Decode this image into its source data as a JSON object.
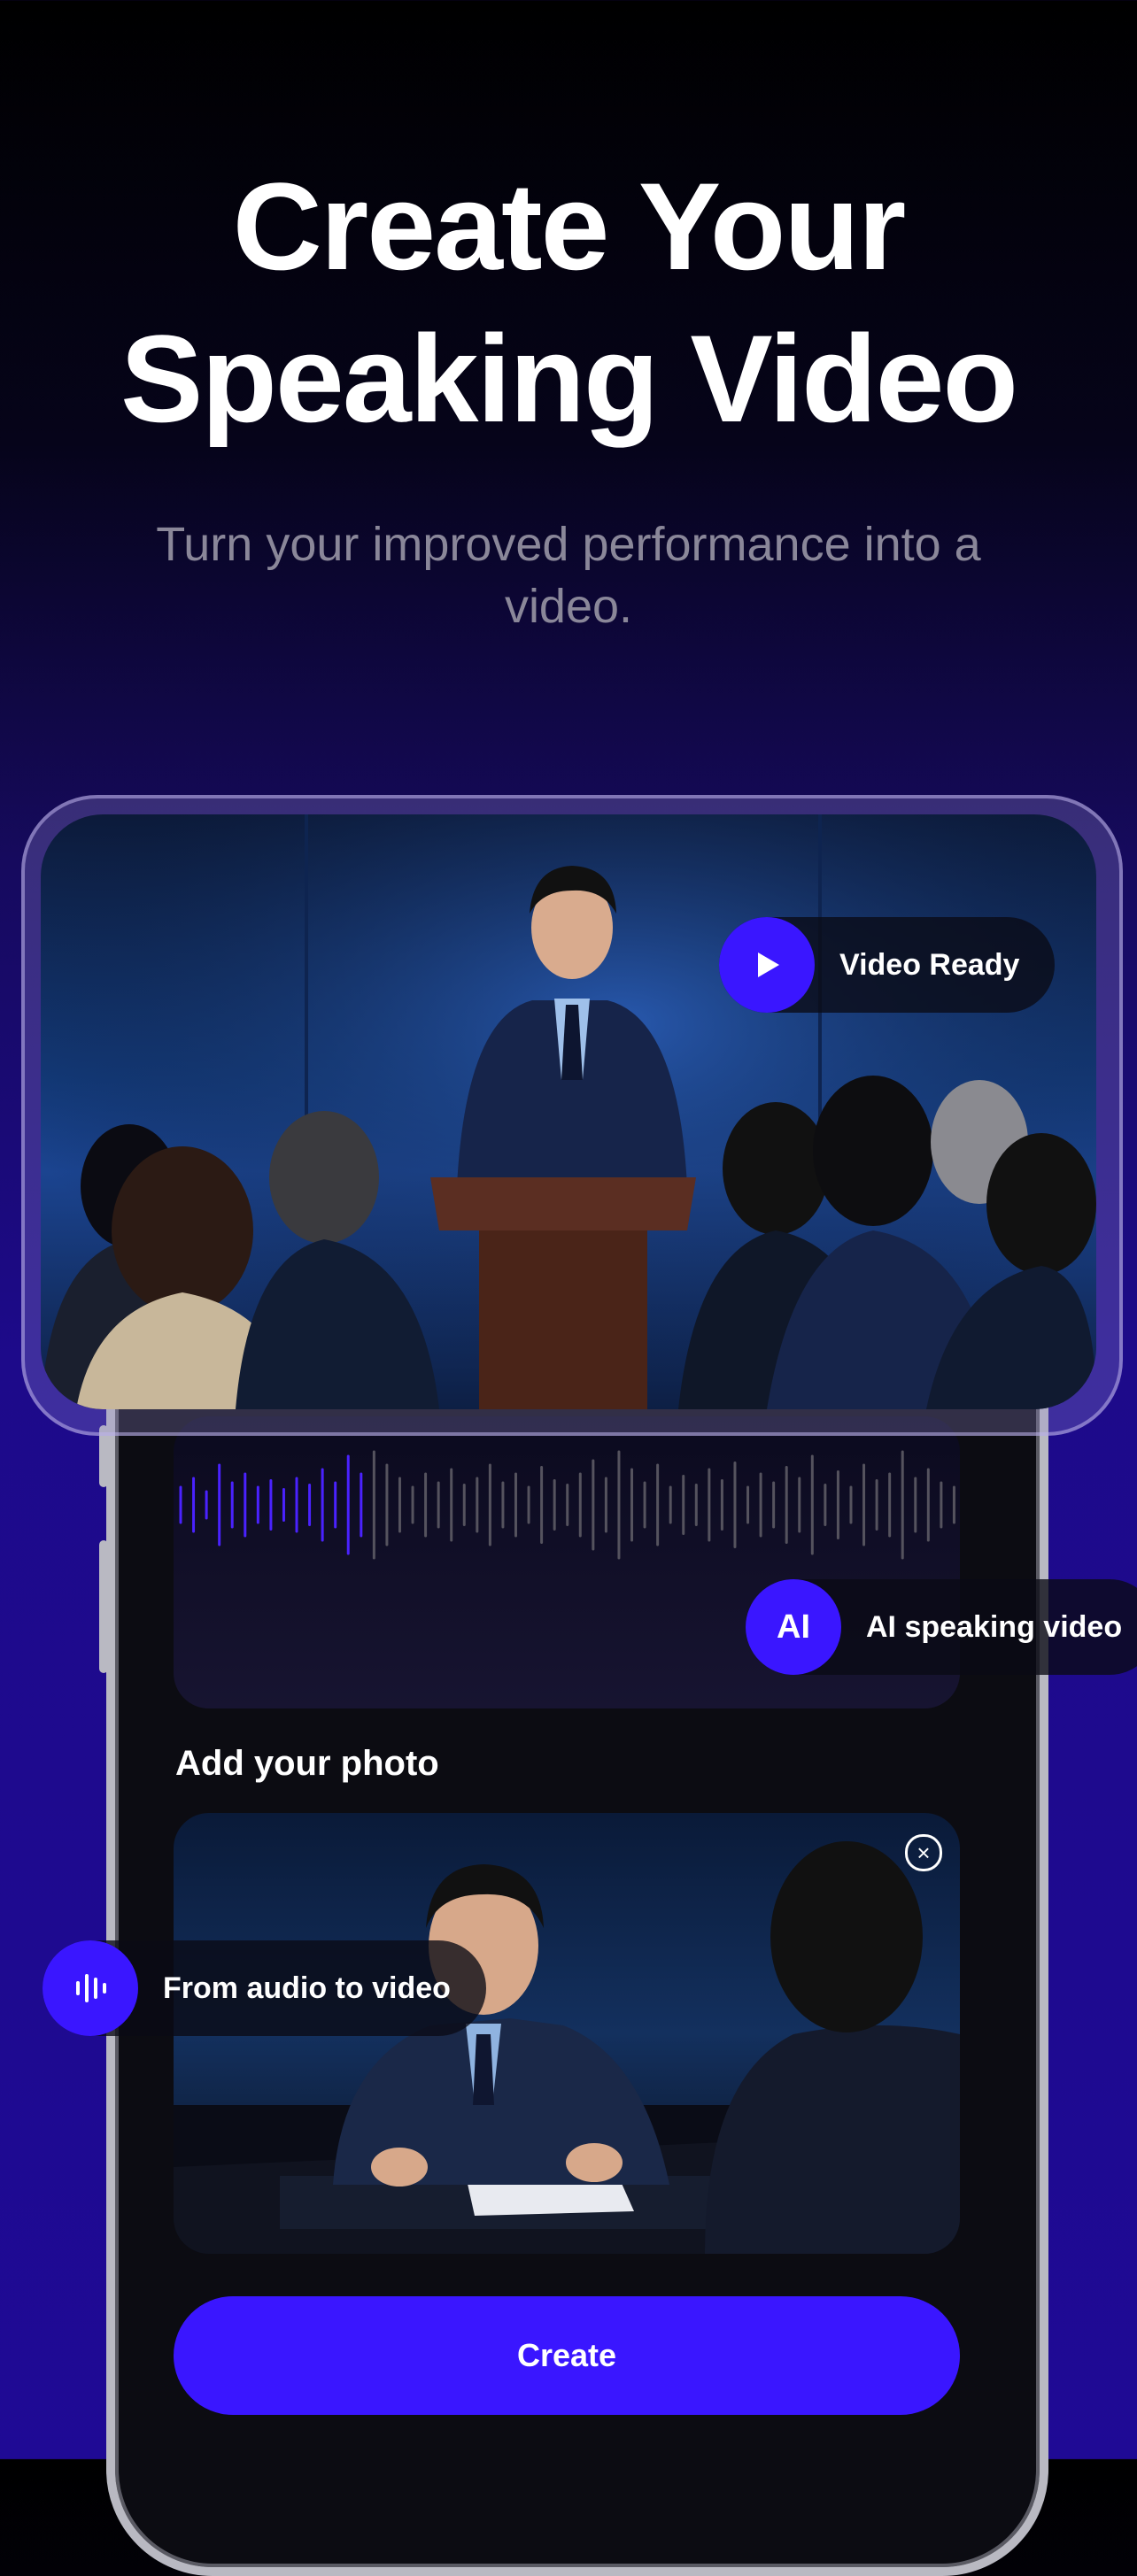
{
  "headline": "Create Your Speaking Video",
  "subtitle": "Turn your improved performance into a video.",
  "badges": {
    "video_ready": "Video Ready",
    "ai_video_icon": "AI",
    "ai_video": "AI speaking video",
    "audio_to_video": "From audio to video"
  },
  "upload": {
    "title": "Add your photo"
  },
  "actions": {
    "create": "Create"
  },
  "icons": [
    "play-icon",
    "audio-bars-icon",
    "close-circle-icon"
  ],
  "colors": {
    "accent": "#3A16FF",
    "waveform_active": "#4A22FF",
    "waveform_inactive": "#55535E"
  }
}
